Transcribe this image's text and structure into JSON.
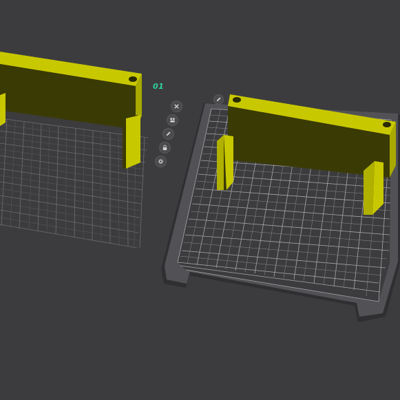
{
  "plates": [
    {
      "label": "01"
    }
  ],
  "toolbar": {
    "buttons": [
      {
        "icon": "close-icon"
      },
      {
        "icon": "arrange-icon"
      },
      {
        "icon": "pencil-icon"
      },
      {
        "icon": "lock-icon"
      },
      {
        "icon": "gear-icon"
      }
    ],
    "plate_top_button": {
      "icon": "pencil-icon"
    }
  },
  "colors": {
    "background": "#3c3c3e",
    "model_face": "#c8c800",
    "model_front": "#3a3a05",
    "plate_frame": "#525256",
    "plate_surface": "#3a3a3c",
    "grid_line": "#a8a8ab",
    "plate_label": "#2fd39a"
  }
}
